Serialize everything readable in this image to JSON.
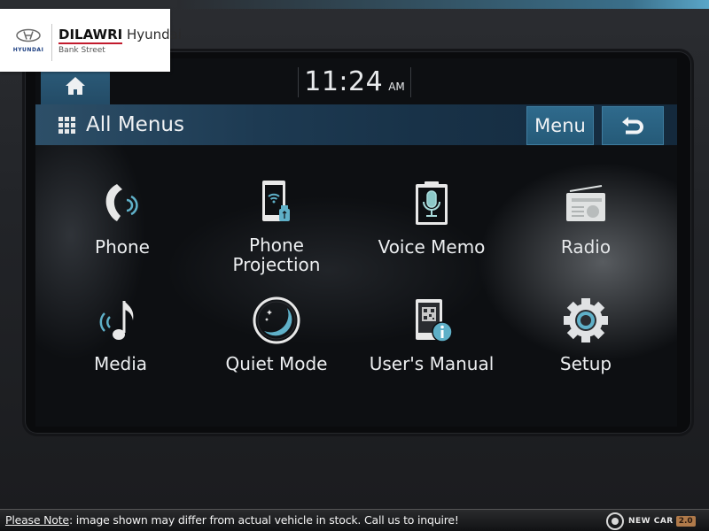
{
  "dealer": {
    "oem_name": "HYUNDAI",
    "brand_bold": "DILAWRI",
    "brand_light": "Hyundai",
    "branch": "Bank Street"
  },
  "status_bar": {
    "home_icon": "home-icon",
    "time": "11:24",
    "ampm": "AM"
  },
  "title_bar": {
    "icon": "grid-icon",
    "title": "All Menus",
    "menu_label": "Menu",
    "back_icon": "back-arrow-icon"
  },
  "apps": [
    {
      "label": "Phone",
      "icon": "phone-icon"
    },
    {
      "label": "Phone Projection",
      "label_line1": "Phone",
      "label_line2": "Projection",
      "icon": "phone-projection-icon"
    },
    {
      "label": "Voice Memo",
      "icon": "voice-memo-icon"
    },
    {
      "label": "Radio",
      "icon": "radio-icon"
    },
    {
      "label": "Media",
      "icon": "media-icon"
    },
    {
      "label": "Quiet Mode",
      "icon": "quiet-mode-icon"
    },
    {
      "label": "User's Manual",
      "icon": "users-manual-icon"
    },
    {
      "label": "Setup",
      "icon": "setup-gear-icon"
    }
  ],
  "colors": {
    "accent_blue": "#2f6a8c",
    "icon_teal": "#5fb0c8",
    "icon_light": "#e6e6e6",
    "dealer_red": "#c21a2c",
    "hyundai_blue": "#1a3d80"
  },
  "footer": {
    "note_label": "Please Note",
    "note_text": ": image shown may differ from actual vehicle in stock. Call us to inquire!",
    "newcar_text": "NEW CAR",
    "newcar_badge": "2.0"
  }
}
